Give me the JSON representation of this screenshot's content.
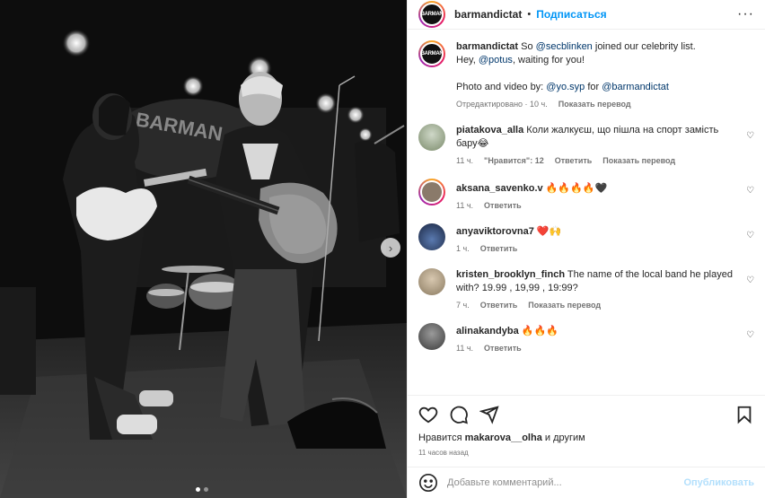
{
  "post": {
    "username": "barmandictat",
    "follow_label": "Подписаться",
    "separator": "•",
    "avatar_text": "BARMAN",
    "more_icon": "more-horizontal-icon"
  },
  "caption": {
    "username": "barmandictat",
    "text_1": "So ",
    "mention_1": "@secblinken",
    "text_2": " joined our celebrity list.",
    "text_3": "Hey, ",
    "mention_2": "@potus",
    "text_4": ", waiting for you!",
    "text_5": "Photo and video by: ",
    "mention_3": "@yo.syp",
    "text_6": " for ",
    "mention_4": "@barmandictat",
    "edited": "Отредактировано · 10 ч.",
    "translate": "Показать перевод"
  },
  "comments": [
    {
      "user": "piatakova_alla",
      "text": "Коли жалкуєш, що пішла на спорт замість бару😂",
      "time": "11 ч.",
      "likes": "\"Нравится\": 12",
      "reply": "Ответить",
      "translate": "Показать перевод"
    },
    {
      "user": "aksana_savenko.v",
      "text": "🔥🔥🔥🔥🖤",
      "time": "11 ч.",
      "reply": "Ответить"
    },
    {
      "user": "anyaviktorovna7",
      "text": "❤️🙌",
      "time": "1 ч.",
      "reply": "Ответить"
    },
    {
      "user": "kristen_brooklyn_finch",
      "text": "The name of the local band he played with? 19.99 , 19,99 , 19:99?",
      "time": "7 ч.",
      "reply": "Ответить",
      "translate": "Показать перевод"
    },
    {
      "user": "alinakandyba",
      "text": "🔥🔥🔥",
      "time": "11 ч.",
      "reply": "Ответить"
    }
  ],
  "likes": {
    "prefix": "Нравится ",
    "user": "makarova__olha",
    "suffix": " и другим"
  },
  "time_ago": "11 часов назад",
  "add_comment": {
    "placeholder": "Добавьте комментарий...",
    "publish": "Опубликовать"
  },
  "carousel": {
    "current": 1,
    "total": 2
  },
  "colors": {
    "link": "#0095f6",
    "mention": "#00376b",
    "meta": "#737373"
  }
}
